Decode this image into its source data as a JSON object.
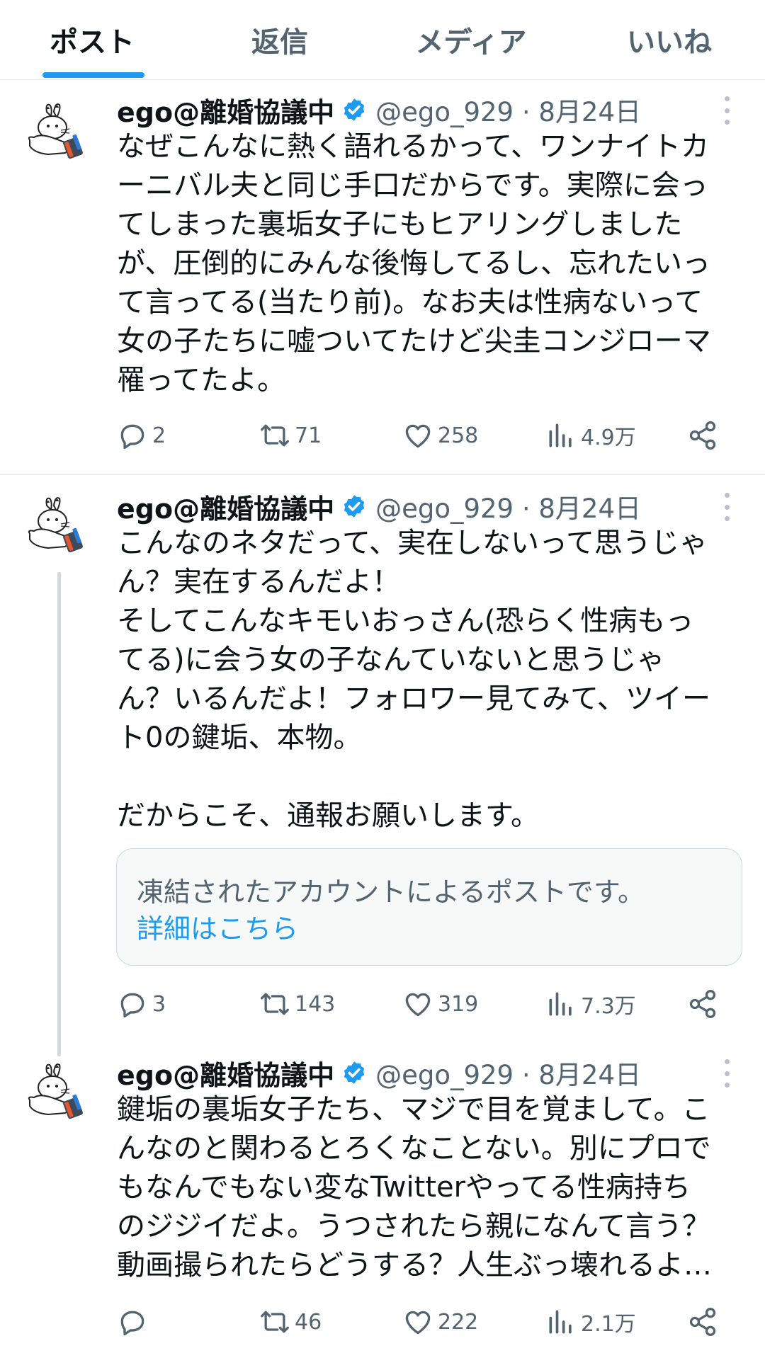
{
  "tabs": [
    {
      "label": "ポスト",
      "active": true
    },
    {
      "label": "返信",
      "active": false
    },
    {
      "label": "メディア",
      "active": false
    },
    {
      "label": "いいね",
      "active": false
    }
  ],
  "colors": {
    "accent": "#1d9bf0",
    "text": "#0f1419",
    "muted": "#536471"
  },
  "posts": [
    {
      "author_name": "ego@離婚協議中",
      "verified": true,
      "handle": "@ego_929",
      "date": "8月24日",
      "meta": "@ego_929 · 8月24日",
      "lines": [
        "なぜこんなに熱く語れるかって、ワンナイトカ",
        "ーニバル夫と同じ手口だからです。実際に会っ",
        "てしまった裏垢女子にもヒアリングしました",
        "が、圧倒的にみんな後悔してるし、忘れたいっ",
        "て言ってる(当たり前)。なお夫は性病ないって",
        "女の子たちに嘘ついてたけど尖圭コンジローマ",
        "罹ってたよ。"
      ],
      "replies": "2",
      "reposts": "71",
      "likes": "258",
      "views": "4.9万"
    },
    {
      "author_name": "ego@離婚協議中",
      "verified": true,
      "handle": "@ego_929",
      "date": "8月24日",
      "meta": "@ego_929 · 8月24日",
      "lines": [
        "こんなのネタだって、実在しないって思うじゃ",
        "ん？実在するんだよ！",
        "そしてこんなキモいおっさん(恐らく性病もっ",
        "てる)に会う女の子なんていないと思うじゃ",
        "ん？いるんだよ！フォロワー見てみて、ツイー",
        "ト0の鍵垢、本物。",
        "",
        "だからこそ、通報お願いします。"
      ],
      "quote_notice": "凍結されたアカウントによるポストです。",
      "quote_link": "詳細はこちら",
      "replies": "3",
      "reposts": "143",
      "likes": "319",
      "views": "7.3万"
    },
    {
      "author_name": "ego@離婚協議中",
      "verified": true,
      "handle": "@ego_929",
      "date": "8月24日",
      "meta": "@ego_929 · 8月24日",
      "lines": [
        "鍵垢の裏垢女子たち、マジで目を覚まして。こ",
        "んなのと関わるとろくなことない。別にプロで",
        "もなんでもない変なTwitterやってる性病持ち",
        "のジジイだよ。うつされたら親になんて言う？",
        "動画撮られたらどうする？人生ぶっ壊れるよ…"
      ],
      "replies": "",
      "reposts": "46",
      "likes": "222",
      "views": "2.1万"
    }
  ],
  "icons": {
    "reply": "reply-icon",
    "repost": "repost-icon",
    "like": "heart-icon",
    "views": "views-icon",
    "share": "share-icon",
    "verified": "verified-badge-icon",
    "more": "more-options-icon"
  }
}
